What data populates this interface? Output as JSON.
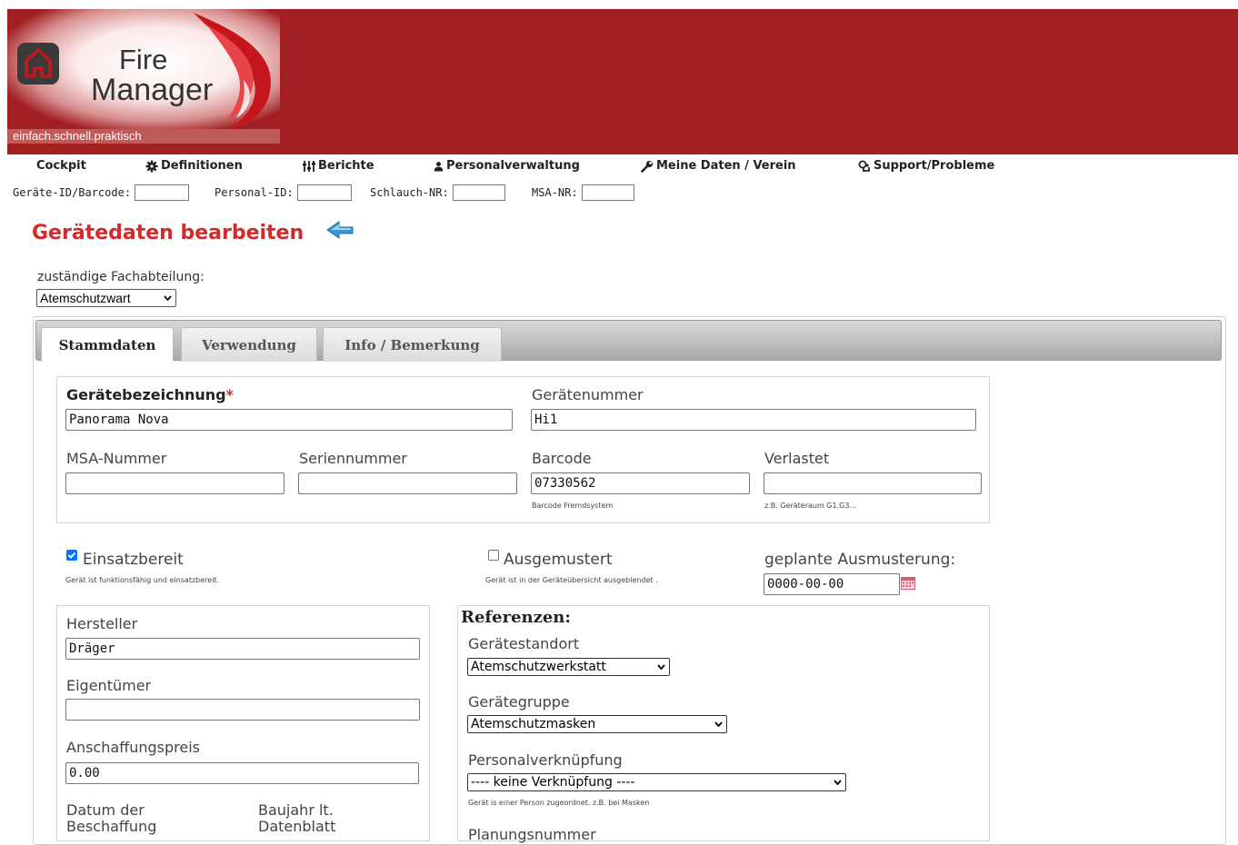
{
  "logo": {
    "line1": "Fire",
    "line2": "Manager",
    "slogan": "einfach.schnell.praktisch"
  },
  "nav": {
    "items": [
      {
        "label": "Cockpit",
        "icon": "none"
      },
      {
        "label": "Definitionen",
        "icon": "gear-icon"
      },
      {
        "label": "Berichte",
        "icon": "bars-icon"
      },
      {
        "label": "Personalverwaltung",
        "icon": "user-icon"
      },
      {
        "label": "Meine Daten / Verein",
        "icon": "wrench-icon"
      },
      {
        "label": "Support/Probleme",
        "icon": "support-icon"
      }
    ]
  },
  "quick_search": {
    "geraete_label": "Geräte-ID/Barcode:",
    "personal_label": "Personal-ID:",
    "schlauch_label": "Schlauch-NR:",
    "msa_label": "MSA-NR:"
  },
  "page": {
    "title": "Gerätedaten bearbeiten",
    "dept_label": "zuständige Fachabteilung:",
    "dept_value": "Atemschutzwart"
  },
  "tabs": [
    {
      "label": "Stammdaten",
      "active": true
    },
    {
      "label": "Verwendung",
      "active": false
    },
    {
      "label": "Info / Bemerkung",
      "active": false
    }
  ],
  "form": {
    "bezeichnung_label": "Gerätebezeichnung",
    "bezeichnung_required": "*",
    "bezeichnung_value": "Panorama Nova",
    "nummer_label": "Gerätenummer",
    "nummer_value": "Hi1",
    "msa_label": "MSA-Nummer",
    "msa_value": "",
    "serien_label": "Seriennummer",
    "serien_value": "",
    "barcode_label": "Barcode",
    "barcode_value": "07330562",
    "barcode_hint": "Barcode Fremdsystem",
    "verlastet_label": "Verlastet",
    "verlastet_value": "",
    "verlastet_hint": "z.B. Geräteraum G1,G3...",
    "einsatz_label": "Einsatzbereit",
    "einsatz_checked": true,
    "einsatz_hint": "Gerät ist funktionsfähig und einsatzbereit.",
    "ausgemustert_label": "Ausgemustert",
    "ausgemustert_checked": false,
    "ausgemustert_hint": "Gerät ist in der Geräteübersicht ausgeblendet .",
    "ausmusterung_label": "geplante Ausmusterung:",
    "ausmusterung_value": "0000-00-00",
    "hersteller_label": "Hersteller",
    "hersteller_value": "Dräger",
    "eigentuemer_label": "Eigentümer",
    "eigentuemer_value": "",
    "preis_label": "Anschaffungspreis",
    "preis_value": "0.00",
    "datum_label_1": "Datum der",
    "datum_label_2": "Beschaffung",
    "baujahr_label_1": "Baujahr lt.",
    "baujahr_label_2": "Datenblatt"
  },
  "referenzen": {
    "title": "Referenzen:",
    "standort_label": "Gerätestandort",
    "standort_value": "Atemschutzwerkstatt",
    "gruppe_label": "Gerätegruppe",
    "gruppe_value": "Atemschutzmasken",
    "personal_label": "Personalverknüpfung",
    "personal_value": "---- keine Verknüpfung ----",
    "personal_hint": "Gerät is einer Person zugeordnet. z.B. bei Masken",
    "planung_label": "Planungsnummer"
  },
  "colors": {
    "banner": "#a11f22",
    "title": "#d42a2a",
    "checkbox": "#0075ff"
  }
}
